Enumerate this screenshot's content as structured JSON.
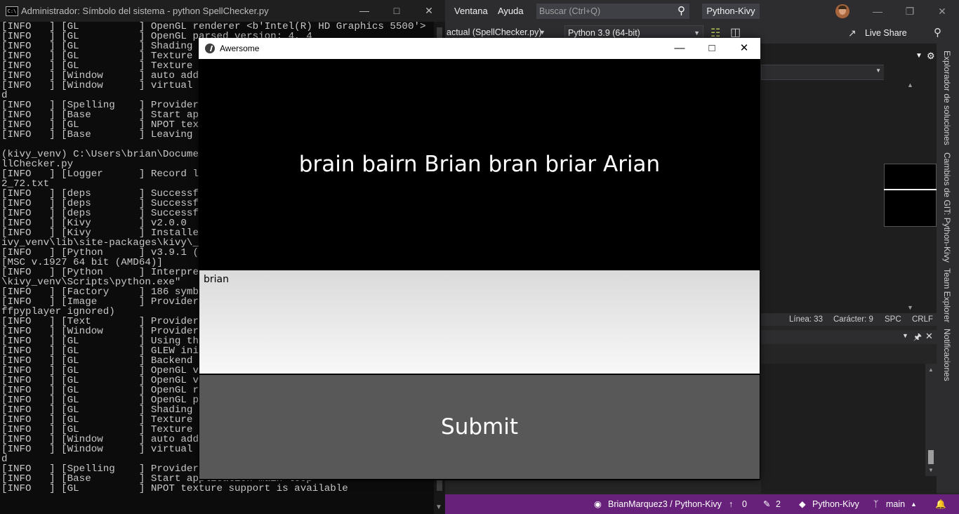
{
  "console": {
    "title": "Administrador: Símbolo del sistema - python  SpellChecker.py",
    "icon": "C:\\",
    "lines": [
      "[INFO   ] [GL          ] OpenGL renderer <b'Intel(R) HD Graphics 5500'>",
      "[INFO   ] [GL          ] OpenGL parsed version: 4, 4",
      "[INFO   ] [GL          ] Shading ve",
      "[INFO   ] [GL          ] Texture ma",
      "[INFO   ] [GL          ] Texture ma",
      "[INFO   ] [Window      ] auto add s",
      "[INFO   ] [Window      ] virtual ke",
      "d",
      "[INFO   ] [Spelling    ] Provider: ",
      "[INFO   ] [Base        ] Start appl",
      "[INFO   ] [GL          ] NPOT textu",
      "[INFO   ] [Base        ] Leaving ap",
      "",
      "(kivy_venv) C:\\Users\\brian\\Documents",
      "llChecker.py",
      "[INFO   ] [Logger      ] Record log",
      "2_72.txt",
      "[INFO   ] [deps        ] Successful",
      "[INFO   ] [deps        ] Successful",
      "[INFO   ] [deps        ] Successful",
      "[INFO   ] [Kivy        ] v2.0.0",
      "[INFO   ] [Kivy        ] Installed ",
      "ivy_venv\\lib\\site-packages\\kivy\\__i",
      "[INFO   ] [Python      ] v3.9.1 (ta",
      "[MSC v.1927 64 bit (AMD64)]",
      "[INFO   ] [Python      ] Interprete",
      "\\kivy_venv\\Scripts\\python.exe\"",
      "[INFO   ] [Factory     ] 186 symbol",
      "[INFO   ] [Image       ] Providers:",
      "ffpyplayer ignored)",
      "[INFO   ] [Text        ] Provider: ",
      "[INFO   ] [Window      ] Provider: ",
      "[INFO   ] [GL          ] Using the ",
      "[INFO   ] [GL          ] GLEW initi",
      "[INFO   ] [GL          ] Backend us",
      "[INFO   ] [GL          ] OpenGL ver",
      "[INFO   ] [GL          ] OpenGL ven",
      "[INFO   ] [GL          ] OpenGL ren",
      "[INFO   ] [GL          ] OpenGL par",
      "[INFO   ] [GL          ] Shading ve",
      "[INFO   ] [GL          ] Texture ma",
      "[INFO   ] [GL          ] Texture ma",
      "[INFO   ] [Window      ] auto add s",
      "[INFO   ] [Window      ] virtual ke",
      "d",
      "[INFO   ] [Spelling    ] Provider: ",
      "[INFO   ] [Base        ] Start application main loop",
      "[INFO   ] [GL          ] NPOT texture support is available"
    ]
  },
  "vs": {
    "menu": {
      "ventana": "Ventana",
      "ayuda": "Ayuda"
    },
    "search_placeholder": "Buscar (Ctrl+Q)",
    "solution_name": "Python-Kivy",
    "toolbar": {
      "file": "actual (SpellChecker.py)",
      "python_env": "Python 3.9 (64-bit)",
      "live_share": "Live Share"
    },
    "side_tabs": [
      "Explorador de soluciones",
      "Cambios de GIT: Python-Kivy",
      "Team Explorer",
      "Notificaciones"
    ],
    "editor_status": {
      "line": "Línea: 33",
      "char": "Carácter: 9",
      "spc": "SPC",
      "crlf": "CRLF"
    },
    "status_bar": {
      "repo": "BrianMarquez3 / Python-Kivy",
      "up": "0",
      "changes": "2",
      "project": "Python-Kivy",
      "branch": "main"
    },
    "colors": {
      "status_bar": "#68217a",
      "chrome": "#2d2d30"
    }
  },
  "kivy": {
    "title": "Awersome",
    "suggestions": "brain bairn Brian bran briar Arian",
    "input_value": "brian",
    "submit_label": "Submit"
  }
}
